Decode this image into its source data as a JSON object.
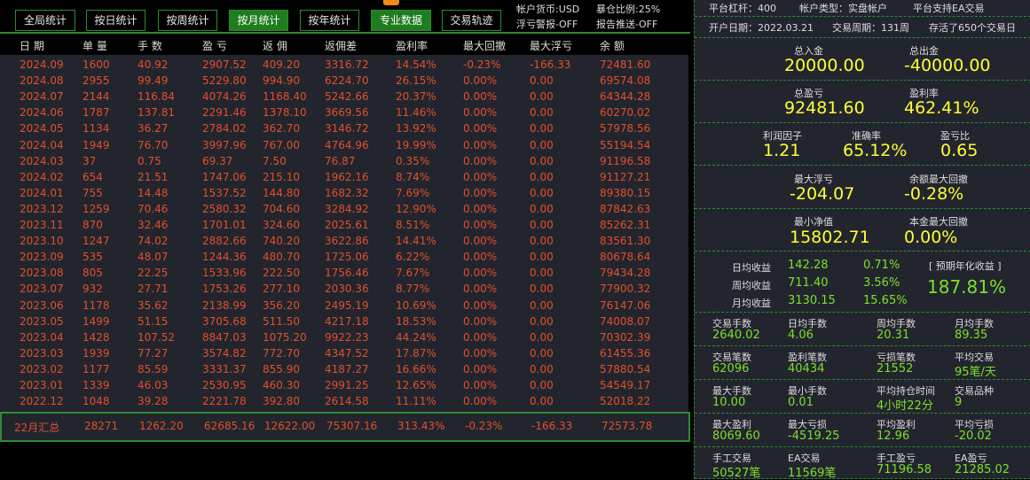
{
  "toolbar": {
    "buttons": [
      "全局统计",
      "按日统计",
      "按周统计",
      "按月统计",
      "按年统计",
      "专业数据",
      "交易轨迹"
    ],
    "active": "按月统计",
    "currency": "帐户货币:USD",
    "margin_ratio": "暴仓比例:25%",
    "float_alert": "浮亏警报-OFF",
    "report_push": "报告推送-OFF"
  },
  "table": {
    "headers": [
      "日 期",
      "单 量",
      "手 数",
      "盈 亏",
      "返 佣",
      "返佣差",
      "盈利率",
      "最大回撤",
      "最大浮亏",
      "余 额"
    ],
    "rows": [
      [
        "2024.09",
        "1600",
        "40.92",
        "2907.52",
        "409.20",
        "3316.72",
        "14.54%",
        "-0.23%",
        "-166.33",
        "72481.60"
      ],
      [
        "2024.08",
        "2955",
        "99.49",
        "5229.80",
        "994.90",
        "6224.70",
        "26.15%",
        "0.00%",
        "0.00",
        "69574.08"
      ],
      [
        "2024.07",
        "2144",
        "116.84",
        "4074.26",
        "1168.40",
        "5242.66",
        "20.37%",
        "0.00%",
        "0.00",
        "64344.28"
      ],
      [
        "2024.06",
        "1787",
        "137.81",
        "2291.46",
        "1378.10",
        "3669.56",
        "11.46%",
        "0.00%",
        "0.00",
        "60270.02"
      ],
      [
        "2024.05",
        "1134",
        "36.27",
        "2784.02",
        "362.70",
        "3146.72",
        "13.92%",
        "0.00%",
        "0.00",
        "57978.56"
      ],
      [
        "2024.04",
        "1949",
        "76.70",
        "3997.96",
        "767.00",
        "4764.96",
        "19.99%",
        "0.00%",
        "0.00",
        "55194.54"
      ],
      [
        "2024.03",
        "37",
        "0.75",
        "69.37",
        "7.50",
        "76.87",
        "0.35%",
        "0.00%",
        "0.00",
        "91196.58"
      ],
      [
        "2024.02",
        "654",
        "21.51",
        "1747.06",
        "215.10",
        "1962.16",
        "8.74%",
        "0.00%",
        "0.00",
        "91127.21"
      ],
      [
        "2024.01",
        "755",
        "14.48",
        "1537.52",
        "144.80",
        "1682.32",
        "7.69%",
        "0.00%",
        "0.00",
        "89380.15"
      ],
      [
        "2023.12",
        "1259",
        "70.46",
        "2580.32",
        "704.60",
        "3284.92",
        "12.90%",
        "0.00%",
        "0.00",
        "87842.63"
      ],
      [
        "2023.11",
        "870",
        "32.46",
        "1701.01",
        "324.60",
        "2025.61",
        "8.51%",
        "0.00%",
        "0.00",
        "85262.31"
      ],
      [
        "2023.10",
        "1247",
        "74.02",
        "2882.66",
        "740.20",
        "3622.86",
        "14.41%",
        "0.00%",
        "0.00",
        "83561.30"
      ],
      [
        "2023.09",
        "535",
        "48.07",
        "1244.36",
        "480.70",
        "1725.06",
        "6.22%",
        "0.00%",
        "0.00",
        "80678.64"
      ],
      [
        "2023.08",
        "805",
        "22.25",
        "1533.96",
        "222.50",
        "1756.46",
        "7.67%",
        "0.00%",
        "0.00",
        "79434.28"
      ],
      [
        "2023.07",
        "932",
        "27.71",
        "1753.26",
        "277.10",
        "2030.36",
        "8.77%",
        "0.00%",
        "0.00",
        "77900.32"
      ],
      [
        "2023.06",
        "1178",
        "35.62",
        "2138.99",
        "356.20",
        "2495.19",
        "10.69%",
        "0.00%",
        "0.00",
        "76147.06"
      ],
      [
        "2023.05",
        "1499",
        "51.15",
        "3705.68",
        "511.50",
        "4217.18",
        "18.53%",
        "0.00%",
        "0.00",
        "74008.07"
      ],
      [
        "2023.04",
        "1428",
        "107.52",
        "8847.03",
        "1075.20",
        "9922.23",
        "44.24%",
        "0.00%",
        "0.00",
        "70302.39"
      ],
      [
        "2023.03",
        "1939",
        "77.27",
        "3574.82",
        "772.70",
        "4347.52",
        "17.87%",
        "0.00%",
        "0.00",
        "61455.36"
      ],
      [
        "2023.02",
        "1177",
        "85.59",
        "3331.37",
        "855.90",
        "4187.27",
        "16.66%",
        "0.00%",
        "0.00",
        "57880.54"
      ],
      [
        "2023.01",
        "1339",
        "46.03",
        "2530.95",
        "460.30",
        "2991.25",
        "12.65%",
        "0.00%",
        "0.00",
        "54549.17"
      ],
      [
        "2022.12",
        "1048",
        "39.28",
        "2221.78",
        "392.80",
        "2614.58",
        "11.11%",
        "0.00%",
        "0.00",
        "52018.22"
      ]
    ],
    "summary": [
      "22月汇总",
      "28271",
      "1262.20",
      "62685.16",
      "12622.00",
      "75307.16",
      "313.43%",
      "-0.23%",
      "-166.33",
      "72573.78"
    ]
  },
  "panel": {
    "line1": [
      "平台杠杆：400",
      "帐户类型：实盘帐户",
      "平台支持EA交易"
    ],
    "line2": [
      "开户日期：2022.03.21",
      "交易周期：131周",
      "存活了650个交易日"
    ],
    "deposit_label": "总入金",
    "deposit": "20000.00",
    "withdraw_label": "总出金",
    "withdraw": "-40000.00",
    "pnl_label": "总盈亏",
    "pnl": "92481.60",
    "roi_label": "盈利率",
    "roi": "462.41%",
    "pf_label": "利润因子",
    "pf": "1.21",
    "acc_label": "准确率",
    "acc": "65.12%",
    "rr_label": "盈亏比",
    "rr": "0.65",
    "maxfloat_label": "最大浮亏",
    "maxfloat": "-204.07",
    "baldd_label": "余额最大回撤",
    "baldd": "-0.28%",
    "mineq_label": "最小净值",
    "mineq": "15802.71",
    "capdd_label": "本金最大回撤",
    "capdd": "0.00%",
    "avg": [
      [
        "日均收益",
        "142.28",
        "0.71%"
      ],
      [
        "周均收益",
        "711.40",
        "3.56%"
      ],
      [
        "月均收益",
        "3130.15",
        "15.65%"
      ]
    ],
    "annual_label": "[ 预期年化收益 ]",
    "annual": "187.81%",
    "grid": [
      [
        [
          "交易手数",
          "2640.02"
        ],
        [
          "日均手数",
          "4.06"
        ],
        [
          "周均手数",
          "20.31"
        ],
        [
          "月均手数",
          "89.35"
        ]
      ],
      [
        [
          "交易笔数",
          "62096"
        ],
        [
          "盈利笔数",
          "40434"
        ],
        [
          "亏损笔数",
          "21552"
        ],
        [
          "平均交易",
          "95笔/天"
        ]
      ],
      [
        [
          "最大手数",
          "10.00"
        ],
        [
          "最小手数",
          "0.01"
        ],
        [
          "平均持仓时间",
          "4小时22分"
        ],
        [
          "交易品种",
          "9"
        ]
      ],
      [
        [
          "最大盈利",
          "8069.60"
        ],
        [
          "最大亏损",
          "-4519.25"
        ],
        [
          "平均盈利",
          "12.96"
        ],
        [
          "平均亏损",
          "-20.02"
        ]
      ],
      [
        [
          "手工交易",
          "50527笔"
        ],
        [
          "EA交易",
          "11569笔"
        ],
        [
          "手工盈亏",
          "71196.58"
        ],
        [
          "EA盈亏",
          "21285.02"
        ]
      ]
    ]
  },
  "colors": {
    "green": "#2e8b2e",
    "red": "#e0502a",
    "yellow": "#ffff33",
    "lime": "#7be02a"
  }
}
